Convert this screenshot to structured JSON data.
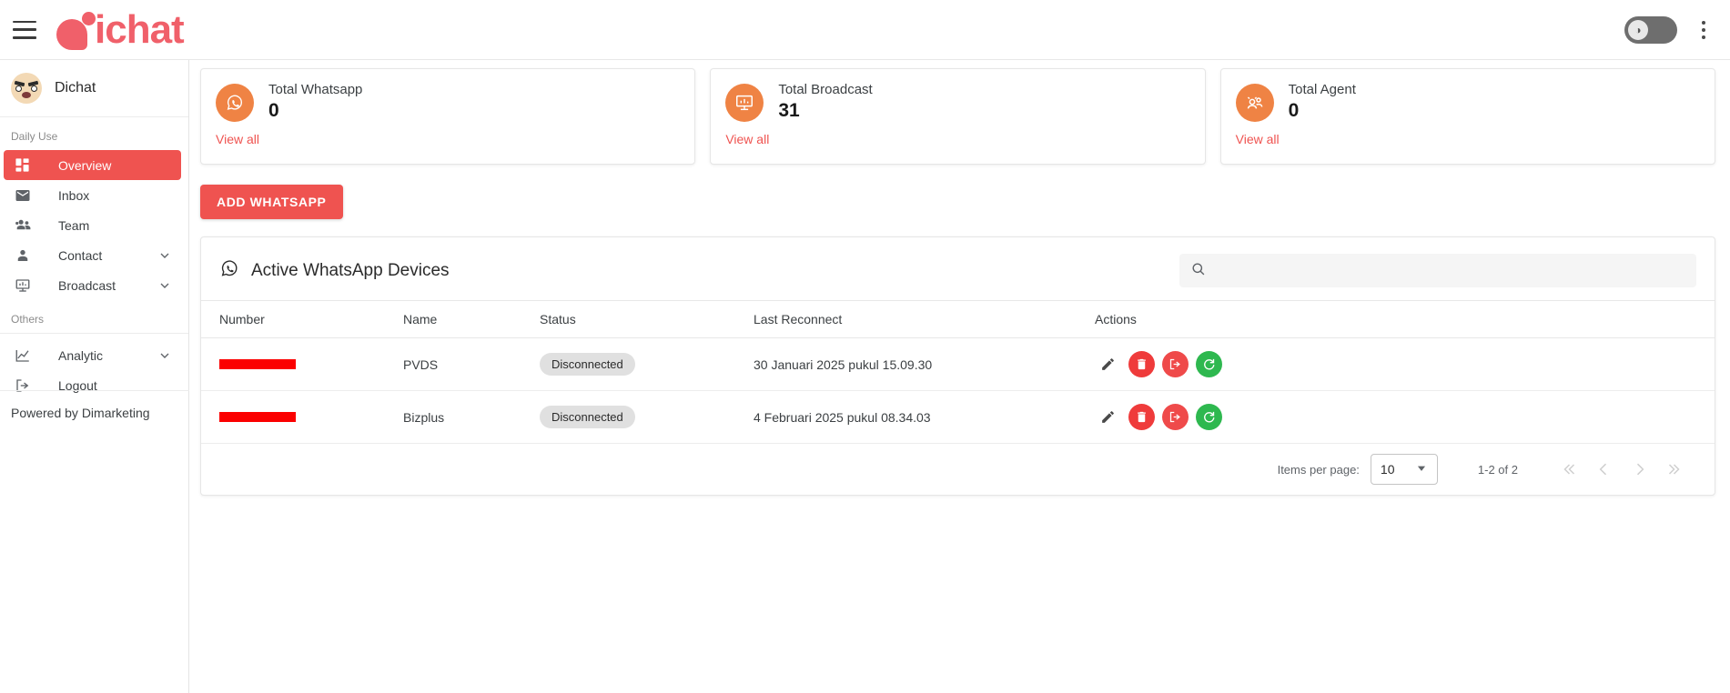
{
  "topbar": {
    "menu_icon": "hamburger-icon",
    "brand": "ichat",
    "theme_toggle_icon": "dark-mode-toggle",
    "overflow_icon": "kebab-menu-icon"
  },
  "sidebar": {
    "profile_name": "Dichat",
    "group_daily": "Daily Use",
    "group_others": "Others",
    "items": [
      {
        "label": "Overview",
        "icon": "dashboard-icon",
        "active": true,
        "expandable": false
      },
      {
        "label": "Inbox",
        "icon": "mail-icon",
        "active": false,
        "expandable": false
      },
      {
        "label": "Team",
        "icon": "people-icon",
        "active": false,
        "expandable": false
      },
      {
        "label": "Contact",
        "icon": "person-icon",
        "active": false,
        "expandable": true
      },
      {
        "label": "Broadcast",
        "icon": "broadcast-icon",
        "active": false,
        "expandable": true
      }
    ],
    "other_items": [
      {
        "label": "Analytic",
        "icon": "analytics-icon",
        "active": false,
        "expandable": true
      },
      {
        "label": "Logout",
        "icon": "logout-icon",
        "active": false,
        "expandable": false
      }
    ],
    "footer": "Powered by Dimarketing"
  },
  "cards": [
    {
      "title": "Total Whatsapp",
      "value": "0",
      "link": "View all",
      "icon": "whatsapp-icon"
    },
    {
      "title": "Total Broadcast",
      "value": "31",
      "link": "View all",
      "icon": "broadcast-icon"
    },
    {
      "title": "Total Agent",
      "value": "0",
      "link": "View all",
      "icon": "agents-icon"
    }
  ],
  "add_button": "ADD WHATSAPP",
  "panel": {
    "title": "Active WhatsApp Devices",
    "title_icon": "whatsapp-icon",
    "search_placeholder": "",
    "search_value": "",
    "columns": [
      "Number",
      "Name",
      "Status",
      "Last Reconnect",
      "Actions"
    ],
    "rows": [
      {
        "number": "",
        "number_redacted": true,
        "name": "PVDS",
        "status": "Disconnected",
        "last_reconnect": "30 Januari 2025 pukul 15.09.30"
      },
      {
        "number": "",
        "number_redacted": true,
        "name": "Bizplus",
        "status": "Disconnected",
        "last_reconnect": "4 Februari 2025 pukul 08.34.03"
      }
    ],
    "row_actions": [
      {
        "name": "edit-button",
        "icon": "pencil-icon"
      },
      {
        "name": "delete-button",
        "icon": "trash-icon"
      },
      {
        "name": "logout-device-button",
        "icon": "logout-icon"
      },
      {
        "name": "refresh-button",
        "icon": "refresh-icon"
      }
    ]
  },
  "paginator": {
    "items_per_page_label": "Items per page:",
    "items_per_page_value": "10",
    "range_label": "1-2 of 2",
    "first_page_icon": "first-page-icon",
    "prev_page_icon": "previous-page-icon",
    "next_page_icon": "next-page-icon",
    "last_page_icon": "last-page-icon"
  },
  "colors": {
    "brand": "#f0606a",
    "accent_red": "#ef5350",
    "orange": "#ef8344",
    "green": "#2eb84f",
    "redact": "#fb0000"
  }
}
